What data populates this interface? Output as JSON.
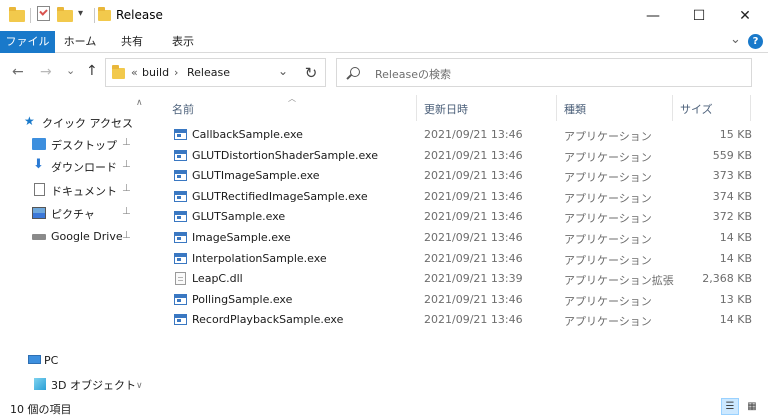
{
  "window": {
    "title": "Release",
    "minimize": "—",
    "maximize": "☐",
    "close": "✕",
    "qat_dropdown": "▾"
  },
  "ribbon": {
    "tabs": [
      {
        "label": "ファイル",
        "active": true
      },
      {
        "label": "ホーム"
      },
      {
        "label": "共有"
      },
      {
        "label": "表示"
      }
    ],
    "expand": "⌄",
    "help": "?"
  },
  "nav": {
    "back": "←",
    "forward": "→",
    "recent": "⌄",
    "up": "↑",
    "path_overflow": "«",
    "breadcrumb": [
      "build",
      "Release"
    ],
    "path_sep": "›",
    "address_dropdown": "⌄",
    "refresh": "↻",
    "search_placeholder": "Releaseの検索"
  },
  "sidebar": {
    "quick_access": "クイック アクセス",
    "items": [
      {
        "label": "デスクトップ",
        "icon": "desktop-icon",
        "pinned": true
      },
      {
        "label": "ダウンロード",
        "icon": "download-icon",
        "pinned": true
      },
      {
        "label": "ドキュメント",
        "icon": "document-icon",
        "pinned": true
      },
      {
        "label": "ピクチャ",
        "icon": "pictures-icon",
        "pinned": true
      },
      {
        "label": "Google Drive",
        "icon": "google-drive-icon",
        "pinned": true
      }
    ],
    "pc": "PC",
    "objects3d": "3D オブジェクト",
    "pin_glyph": "📌"
  },
  "columns": {
    "name": "名前",
    "date": "更新日時",
    "type": "種類",
    "size": "サイズ"
  },
  "files": [
    {
      "name": "CallbackSample.exe",
      "date": "2021/09/21 13:46",
      "type": "アプリケーション",
      "size": "15 KB",
      "kind": "exe"
    },
    {
      "name": "GLUTDistortionShaderSample.exe",
      "date": "2021/09/21 13:46",
      "type": "アプリケーション",
      "size": "559 KB",
      "kind": "exe"
    },
    {
      "name": "GLUTImageSample.exe",
      "date": "2021/09/21 13:46",
      "type": "アプリケーション",
      "size": "373 KB",
      "kind": "exe"
    },
    {
      "name": "GLUTRectifiedImageSample.exe",
      "date": "2021/09/21 13:46",
      "type": "アプリケーション",
      "size": "374 KB",
      "kind": "exe"
    },
    {
      "name": "GLUTSample.exe",
      "date": "2021/09/21 13:46",
      "type": "アプリケーション",
      "size": "372 KB",
      "kind": "exe"
    },
    {
      "name": "ImageSample.exe",
      "date": "2021/09/21 13:46",
      "type": "アプリケーション",
      "size": "14 KB",
      "kind": "exe"
    },
    {
      "name": "InterpolationSample.exe",
      "date": "2021/09/21 13:46",
      "type": "アプリケーション",
      "size": "14 KB",
      "kind": "exe"
    },
    {
      "name": "LeapC.dll",
      "date": "2021/09/21 13:39",
      "type": "アプリケーション拡張",
      "size": "2,368 KB",
      "kind": "dll"
    },
    {
      "name": "PollingSample.exe",
      "date": "2021/09/21 13:46",
      "type": "アプリケーション",
      "size": "13 KB",
      "kind": "exe"
    },
    {
      "name": "RecordPlaybackSample.exe",
      "date": "2021/09/21 13:46",
      "type": "アプリケーション",
      "size": "14 KB",
      "kind": "exe"
    }
  ],
  "status": {
    "item_count": "10 個の項目"
  },
  "colors": {
    "accent": "#1979ca",
    "folder": "#f2c94c",
    "exe_icon": "#3a78c2"
  }
}
